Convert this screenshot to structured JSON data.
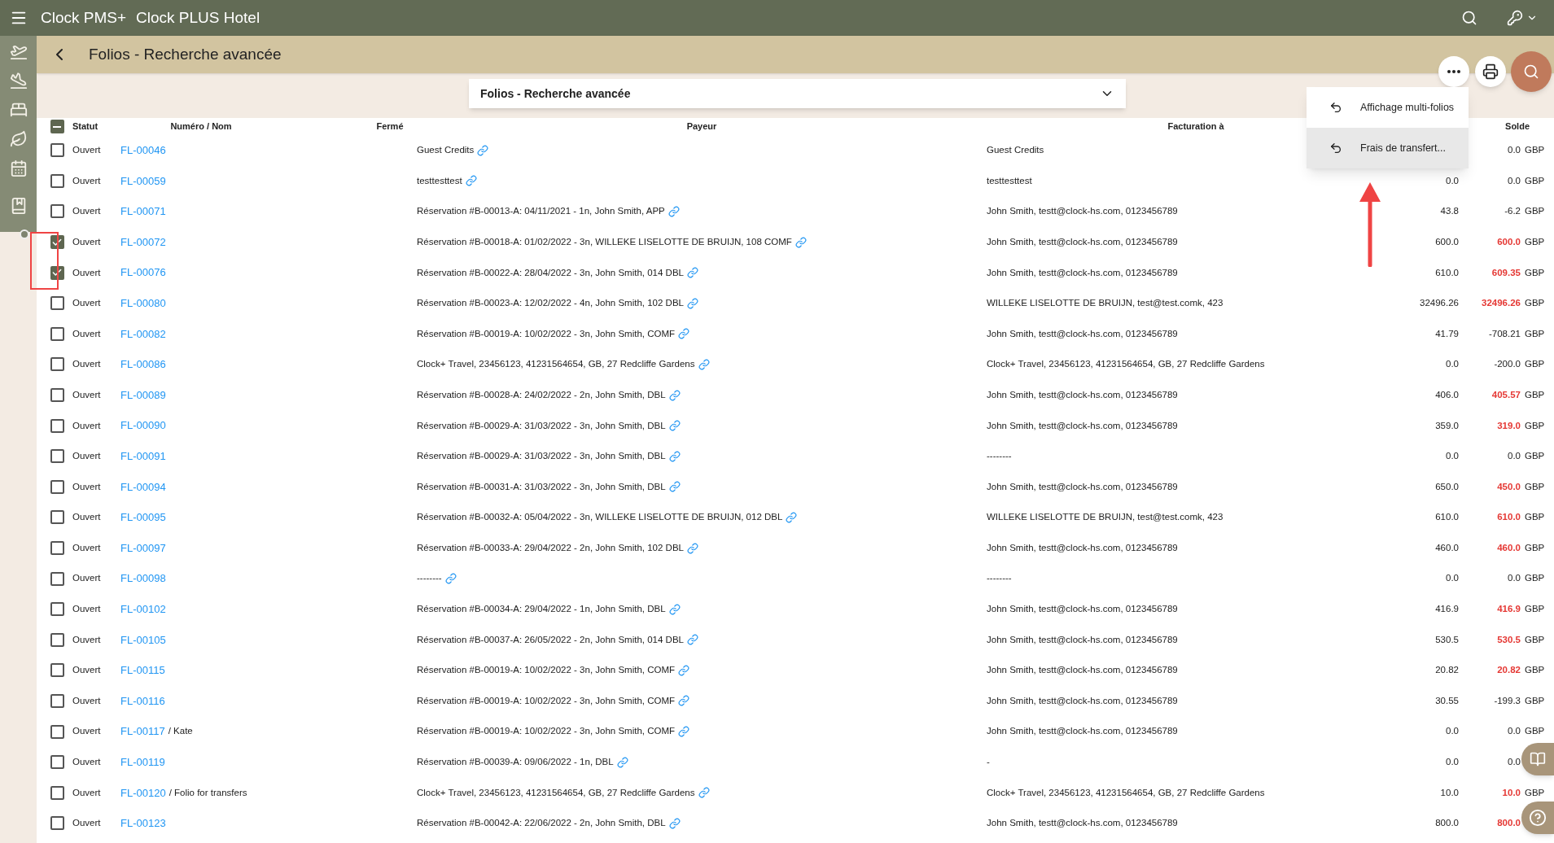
{
  "app_bar": {
    "brand": "Clock PMS+",
    "hotel": "Clock PLUS Hotel"
  },
  "page_title": "Folios - Recherche avancée",
  "search_panel": {
    "title": "Folios - Recherche avancée",
    "expanded": false
  },
  "menu": {
    "items": [
      {
        "label": "Affichage multi-folios",
        "selected": false
      },
      {
        "label": "Frais de transfert...",
        "selected": true
      }
    ]
  },
  "table": {
    "columns": [
      "Statut",
      "Numéro / Nom",
      "Fermé",
      "Payeur",
      "Facturation à",
      "Solde"
    ],
    "some_selected": true,
    "rows": [
      {
        "selected": false,
        "status": "Ouvert",
        "number": "FL-00046",
        "payer": "Guest Credits",
        "billing": "Guest Credits",
        "balance": "0.0",
        "highlight": false,
        "currency": "GBP"
      },
      {
        "selected": false,
        "status": "Ouvert",
        "number": "FL-00059",
        "payer": "testtesttest",
        "billing": "testtesttest",
        "column_6": "0.0",
        "balance": "0.0",
        "highlight": false,
        "currency": "GBP"
      },
      {
        "selected": false,
        "status": "Ouvert",
        "number": "FL-00071",
        "payer": "Réservation #B-00013-A: 04/11/2021 - 1n, John Smith, APP",
        "billing": "John Smith, testt@clock-hs.com, 0123456789",
        "column_6": "43.8",
        "balance": "-6.2",
        "highlight": false,
        "currency": "GBP"
      },
      {
        "selected": true,
        "status": "Ouvert",
        "number": "FL-00072",
        "payer": "Réservation #B-00018-A: 01/02/2022 - 3n, WILLEKE LISELOTTE DE BRUIJN, 108 COMF",
        "billing": "John Smith, testt@clock-hs.com, 0123456789",
        "column_6": "600.0",
        "balance": "600.0",
        "highlight": true,
        "currency": "GBP"
      },
      {
        "selected": true,
        "status": "Ouvert",
        "number": "FL-00076",
        "payer": "Réservation #B-00022-A: 28/04/2022 - 3n, John Smith, 014 DBL",
        "billing": "John Smith, testt@clock-hs.com, 0123456789",
        "column_6": "610.0",
        "balance": "609.35",
        "highlight": true,
        "currency": "GBP"
      },
      {
        "selected": false,
        "status": "Ouvert",
        "number": "FL-00080",
        "payer": "Réservation #B-00023-A: 12/02/2022 - 4n, John Smith, 102 DBL",
        "billing": "WILLEKE LISELOTTE DE BRUIJN, test@test.comk, 423",
        "column_6": "32496.26",
        "balance": "32496.26",
        "highlight": true,
        "currency": "GBP"
      },
      {
        "selected": false,
        "status": "Ouvert",
        "number": "FL-00082",
        "payer": "Réservation #B-00019-A: 10/02/2022 - 3n, John Smith, COMF",
        "billing": "John Smith, testt@clock-hs.com, 0123456789",
        "column_6": "41.79",
        "balance": "-708.21",
        "highlight": false,
        "currency": "GBP"
      },
      {
        "selected": false,
        "status": "Ouvert",
        "number": "FL-00086",
        "payer": "Clock+ Travel, 23456123, 41231564654, GB, 27 Redcliffe Gardens",
        "billing": "Clock+ Travel, 23456123, 41231564654, GB, 27 Redcliffe Gardens",
        "column_6": "0.0",
        "balance": "-200.0",
        "highlight": false,
        "currency": "GBP"
      },
      {
        "selected": false,
        "status": "Ouvert",
        "number": "FL-00089",
        "payer": "Réservation #B-00028-A: 24/02/2022 - 2n, John Smith, DBL",
        "billing": "John Smith, testt@clock-hs.com, 0123456789",
        "column_6": "406.0",
        "balance": "405.57",
        "highlight": true,
        "currency": "GBP"
      },
      {
        "selected": false,
        "status": "Ouvert",
        "number": "FL-00090",
        "payer": "Réservation #B-00029-A: 31/03/2022 - 3n, John Smith, DBL",
        "billing": "John Smith, testt@clock-hs.com, 0123456789",
        "column_6": "359.0",
        "balance": "319.0",
        "highlight": true,
        "currency": "GBP"
      },
      {
        "selected": false,
        "status": "Ouvert",
        "number": "FL-00091",
        "payer": "Réservation #B-00029-A: 31/03/2022 - 3n, John Smith, DBL",
        "billing": "--------",
        "column_6": "0.0",
        "balance": "0.0",
        "highlight": false,
        "currency": "GBP"
      },
      {
        "selected": false,
        "status": "Ouvert",
        "number": "FL-00094",
        "payer": "Réservation #B-00031-A: 31/03/2022 - 3n, John Smith, DBL",
        "billing": "John Smith, testt@clock-hs.com, 0123456789",
        "column_6": "650.0",
        "balance": "450.0",
        "highlight": true,
        "currency": "GBP"
      },
      {
        "selected": false,
        "status": "Ouvert",
        "number": "FL-00095",
        "payer": "Réservation #B-00032-A: 05/04/2022 - 3n, WILLEKE LISELOTTE DE BRUIJN, 012 DBL",
        "billing": "WILLEKE LISELOTTE DE BRUIJN, test@test.comk, 423",
        "column_6": "610.0",
        "balance": "610.0",
        "highlight": true,
        "currency": "GBP"
      },
      {
        "selected": false,
        "status": "Ouvert",
        "number": "FL-00097",
        "payer": "Réservation #B-00033-A: 29/04/2022 - 2n, John Smith, 102 DBL",
        "billing": "John Smith, testt@clock-hs.com, 0123456789",
        "column_6": "460.0",
        "balance": "460.0",
        "highlight": true,
        "currency": "GBP"
      },
      {
        "selected": false,
        "status": "Ouvert",
        "number": "FL-00098",
        "payer": "--------",
        "billing": "--------",
        "column_6": "0.0",
        "balance": "0.0",
        "highlight": false,
        "currency": "GBP"
      },
      {
        "selected": false,
        "status": "Ouvert",
        "number": "FL-00102",
        "payer": "Réservation #B-00034-A: 29/04/2022 - 1n, John Smith, DBL",
        "billing": "John Smith, testt@clock-hs.com, 0123456789",
        "column_6": "416.9",
        "balance": "416.9",
        "highlight": true,
        "currency": "GBP"
      },
      {
        "selected": false,
        "status": "Ouvert",
        "number": "FL-00105",
        "payer": "Réservation #B-00037-A: 26/05/2022 - 2n, John Smith, 014 DBL",
        "billing": "John Smith, testt@clock-hs.com, 0123456789",
        "column_6": "530.5",
        "balance": "530.5",
        "highlight": true,
        "currency": "GBP"
      },
      {
        "selected": false,
        "status": "Ouvert",
        "number": "FL-00115",
        "payer": "Réservation #B-00019-A: 10/02/2022 - 3n, John Smith, COMF",
        "billing": "John Smith, testt@clock-hs.com, 0123456789",
        "column_6": "20.82",
        "balance": "20.82",
        "highlight": true,
        "currency": "GBP"
      },
      {
        "selected": false,
        "status": "Ouvert",
        "number": "FL-00116",
        "payer": "Réservation #B-00019-A: 10/02/2022 - 3n, John Smith, COMF",
        "billing": "John Smith, testt@clock-hs.com, 0123456789",
        "column_6": "30.55",
        "balance": "-199.3",
        "highlight": false,
        "currency": "GBP"
      },
      {
        "selected": false,
        "status": "Ouvert",
        "number": "FL-00117",
        "name": "/ Kate",
        "payer": "Réservation #B-00019-A: 10/02/2022 - 3n, John Smith, COMF",
        "billing": "John Smith, testt@clock-hs.com, 0123456789",
        "column_6": "0.0",
        "balance": "0.0",
        "highlight": false,
        "currency": "GBP"
      },
      {
        "selected": false,
        "status": "Ouvert",
        "number": "FL-00119",
        "payer": "Réservation #B-00039-A: 09/06/2022 - 1n, DBL",
        "billing": "-",
        "column_6": "0.0",
        "balance": "0.0",
        "highlight": false
      },
      {
        "selected": false,
        "status": "Ouvert",
        "number": "FL-00120",
        "name": "/ Folio for transfers",
        "payer": "Clock+ Travel, 23456123, 41231564654, GB, 27 Redcliffe Gardens",
        "billing": "Clock+ Travel, 23456123, 41231564654, GB, 27 Redcliffe Gardens",
        "column_6": "10.0",
        "balance": "10.0",
        "highlight": true,
        "currency": "GBP"
      },
      {
        "selected": false,
        "status": "Ouvert",
        "number": "FL-00123",
        "payer": "Réservation #B-00042-A: 22/06/2022 - 2n, John Smith, DBL",
        "billing": "John Smith, testt@clock-hs.com, 0123456789",
        "column_6": "800.0",
        "balance": "800.0",
        "highlight": true
      }
    ]
  }
}
